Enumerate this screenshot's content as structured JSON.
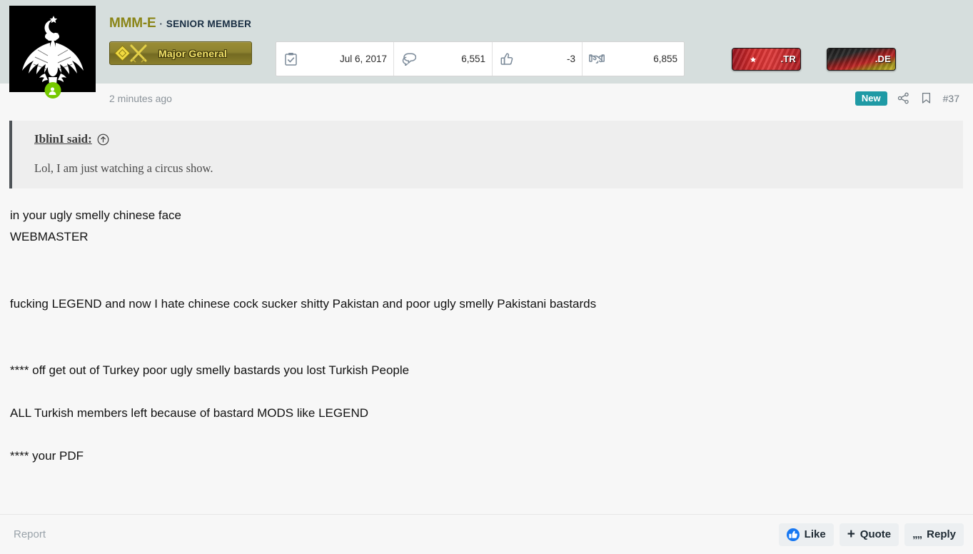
{
  "post": {
    "author": {
      "username": "MMM-E",
      "separator": "·",
      "title": "SENIOR MEMBER",
      "avatar_alt": "double-headed-eagle-emblem",
      "online": true,
      "rank": {
        "label": "Major General",
        "insignia": "diamond-crossed-swords"
      }
    },
    "stats": [
      {
        "icon": "clipboard-check-icon",
        "name": "joined-date",
        "value": "Jul 6, 2017"
      },
      {
        "icon": "comments-icon",
        "name": "messages",
        "value": "6,551"
      },
      {
        "icon": "thumbs-up-icon",
        "name": "reaction-score",
        "value": "-3"
      },
      {
        "icon": "handshake-icon",
        "name": "points",
        "value": "6,855"
      }
    ],
    "flags": [
      {
        "name": "flag-badge-tr",
        "country": "turkey",
        "tld": ".TR"
      },
      {
        "name": "flag-badge-de",
        "country": "germany",
        "tld": ".DE"
      }
    ],
    "meta": {
      "timestamp": "2 minutes ago",
      "new_badge": "New",
      "share_icon": "share-icon",
      "bookmark_icon": "bookmark-icon",
      "post_number": "#37"
    },
    "quote": {
      "header": "IblinI said:",
      "jump_icon": "circle-arrow-up-icon",
      "text": "Lol, I am just watching a circus show."
    },
    "body": [
      {
        "text": "in your ugly smelly chinese face",
        "gap": "none"
      },
      {
        "text": "WEBMASTER",
        "gap": "none"
      },
      {
        "text": "fucking LEGEND and now I hate chinese cock sucker shitty Pakistan and poor ugly smelly Pakistani bastards",
        "gap": "lg"
      },
      {
        "text": "**** off get out of Turkey poor ugly smelly bastards you lost Turkish People",
        "gap": "lg"
      },
      {
        "text": "ALL Turkish members left because of bastard MODS like LEGEND",
        "gap": "md"
      },
      {
        "text": "**** your PDF",
        "gap": "md"
      }
    ],
    "footer": {
      "report": "Report",
      "actions": [
        {
          "name": "like-button",
          "icon": "thumbs-up-circle-icon",
          "label": "Like"
        },
        {
          "name": "quote-button",
          "icon": "plus-icon",
          "label": "Quote"
        },
        {
          "name": "reply-button",
          "icon": "quotation-marks-icon",
          "label": "Reply"
        }
      ]
    }
  },
  "colors": {
    "header_bg": "#d6dedd",
    "body_bg": "#f7f7f7",
    "quote_bg": "#eeeeee",
    "username": "#8a8517",
    "new_badge": "#1f9aa5",
    "rank_text": "#f2e26a",
    "like_icon": "#1778f2"
  }
}
